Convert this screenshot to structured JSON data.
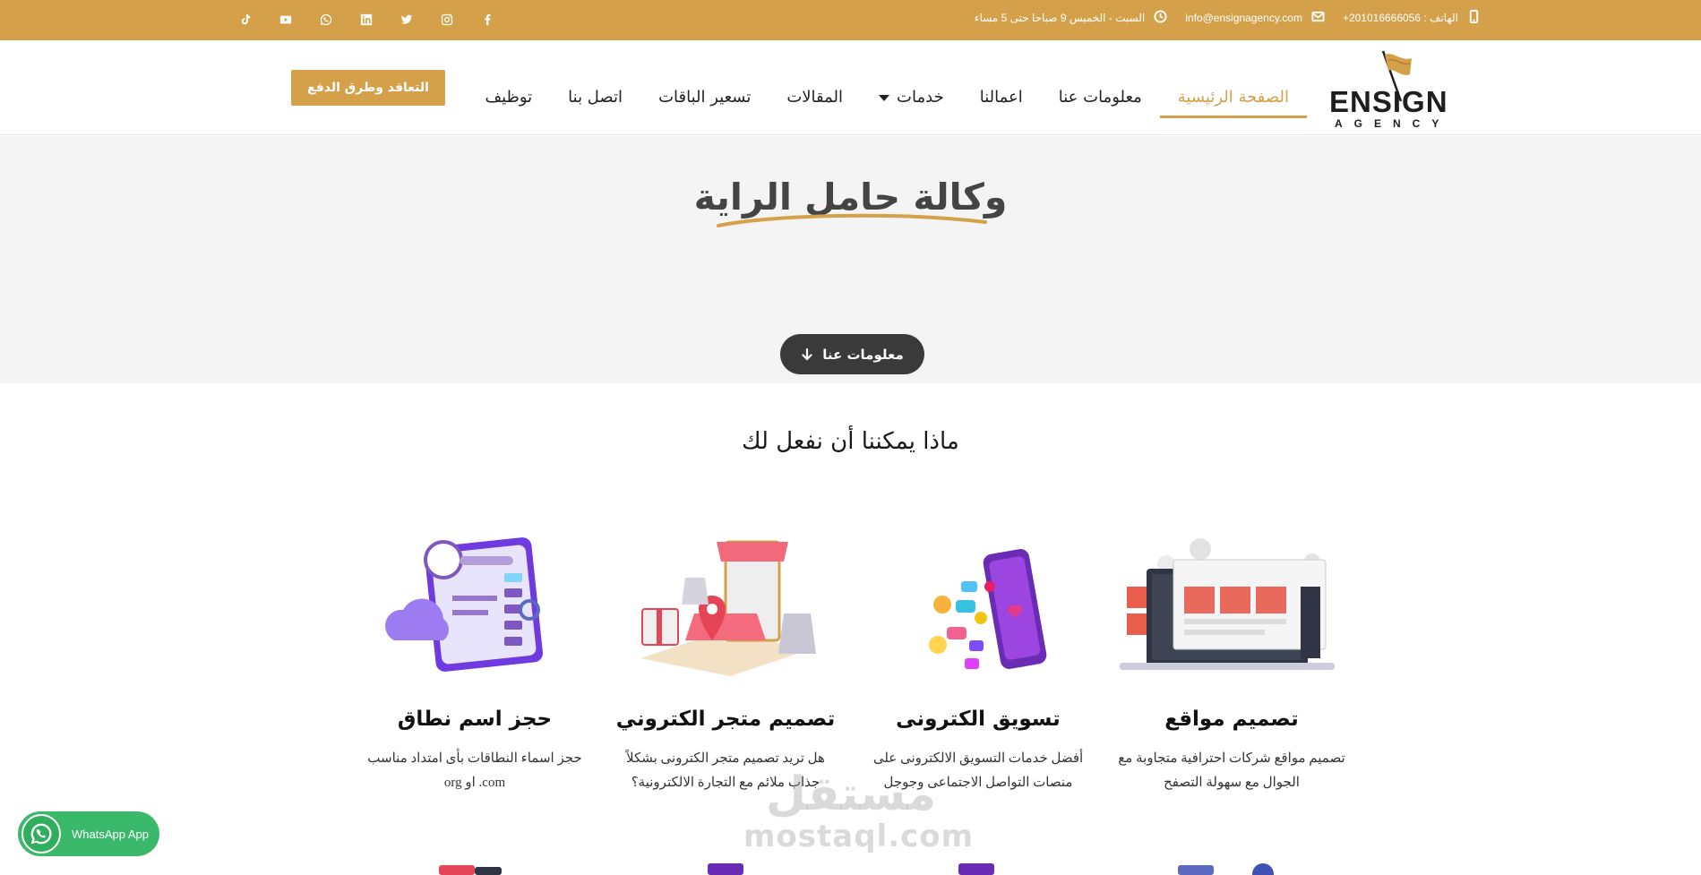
{
  "topbar": {
    "phone": "الهاتف : 201016666056+",
    "email": "info@ensignagency.com",
    "hours": "السبت - الخميس 9 صباحا حتى 5 مساء",
    "social_icons": [
      "tiktok-icon",
      "youtube-icon",
      "whatsapp-icon",
      "linkedin-icon",
      "twitter-icon",
      "instagram-icon",
      "facebook-icon"
    ]
  },
  "logo": {
    "word": "ENSIGN",
    "sub": "AGENCY"
  },
  "nav": {
    "items": [
      {
        "label": "الصفحة الرئيسية",
        "active": true
      },
      {
        "label": "معلومات عنا"
      },
      {
        "label": "اعمالنا"
      },
      {
        "label": "خدمات"
      },
      {
        "label": "المقالات"
      },
      {
        "label": "تسعير الباقات"
      },
      {
        "label": "اتصل بنا"
      },
      {
        "label": "توظيف"
      }
    ],
    "cta": "التعاقد وطرق الدفع"
  },
  "hero": {
    "title": "وكالة حامل الراية",
    "button": "معلومات عنا"
  },
  "services": {
    "title": "ماذا يمكننا أن نفعل لك",
    "cards": [
      {
        "title": "تصميم مواقع",
        "text": "تصميم مواقع شركات احترافية متجاوبة مع الجوال مع سهولة التصفح"
      },
      {
        "title": "تسويق الكترونى",
        "text": "أفضل خدمات التسويق الالكترونى على منصات التواصل الاجتماعى وجوجل"
      },
      {
        "title": "تصميم متجر الكتروني",
        "text": "هل تريد تصميم متجر الكترونى بشكلاً جذاب ملائم مع التجارة الالكترونية؟"
      },
      {
        "title": "حجز اسم نطاق",
        "text": "حجز اسماء النطاقات بأى امتداد مناسب com. او org"
      }
    ]
  },
  "whatsapp": {
    "label": "WhatsApp App"
  },
  "watermark": {
    "arabic": "مستقل",
    "latin": "mostaql.com"
  },
  "colors": {
    "accent": "#d4a049",
    "dark_button": "#3a3a3a",
    "whatsapp": "#3bb96b"
  }
}
